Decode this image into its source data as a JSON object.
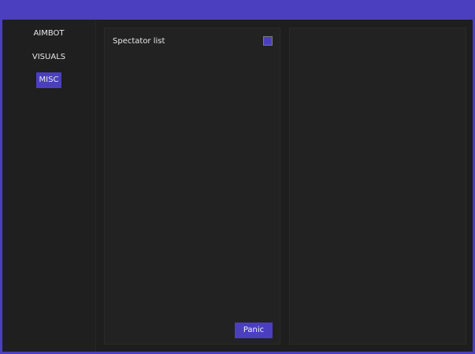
{
  "colors": {
    "accent": "#4b3fc0",
    "background": "#1e1e1e",
    "panel": "#222222",
    "text": "#e8e8e8"
  },
  "sidebar": {
    "tabs": [
      {
        "label": "AIMBOT",
        "active": false
      },
      {
        "label": "VISUALS",
        "active": false
      },
      {
        "label": "MISC",
        "active": true
      }
    ]
  },
  "misc": {
    "options": [
      {
        "label": "Spectator list",
        "checked": true
      }
    ],
    "panic_label": "Panic"
  }
}
